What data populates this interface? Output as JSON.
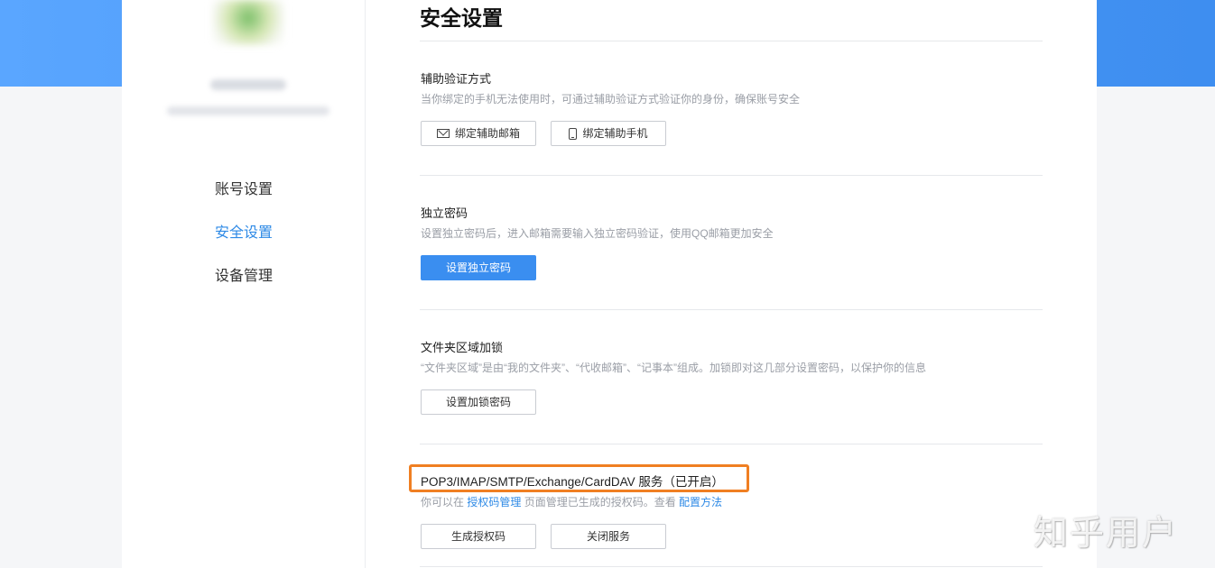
{
  "sidebar": {
    "items": [
      {
        "label": "账号设置",
        "active": false
      },
      {
        "label": "安全设置",
        "active": true
      },
      {
        "label": "设备管理",
        "active": false
      }
    ]
  },
  "main": {
    "title": "安全设置",
    "sections": [
      {
        "title": "辅助验证方式",
        "desc": "当你绑定的手机无法使用时，可通过辅助验证方式验证你的身份，确保账号安全",
        "buttons": [
          {
            "label": "绑定辅助邮箱",
            "icon": "mail-icon"
          },
          {
            "label": "绑定辅助手机",
            "icon": "phone-icon"
          }
        ]
      },
      {
        "title": "独立密码",
        "desc": "设置独立密码后，进入邮箱需要输入独立密码验证，使用QQ邮箱更加安全",
        "buttons": [
          {
            "label": "设置独立密码",
            "primary": true
          }
        ]
      },
      {
        "title": "文件夹区域加锁",
        "desc": "“文件夹区域”是由“我的文件夹”、“代收邮箱”、“记事本”组成。加锁即对这几部分设置密码，以保护你的信息",
        "buttons": [
          {
            "label": "设置加锁密码"
          }
        ]
      },
      {
        "title": "POP3/IMAP/SMTP/Exchange/CardDAV 服务（已开启）",
        "desc_prefix": "你可以在 ",
        "desc_link1": "授权码管理",
        "desc_middle": " 页面管理已生成的授权码。查看 ",
        "desc_link2": "配置方法",
        "buttons": [
          {
            "label": "生成授权码"
          },
          {
            "label": "关闭服务"
          }
        ],
        "highlight_color": "#f07f22"
      }
    ]
  },
  "watermark": "知乎用户",
  "colors": {
    "accent": "#2e8ae6",
    "primary_button": "#3a8ef0",
    "banner": "#4a97f6"
  }
}
